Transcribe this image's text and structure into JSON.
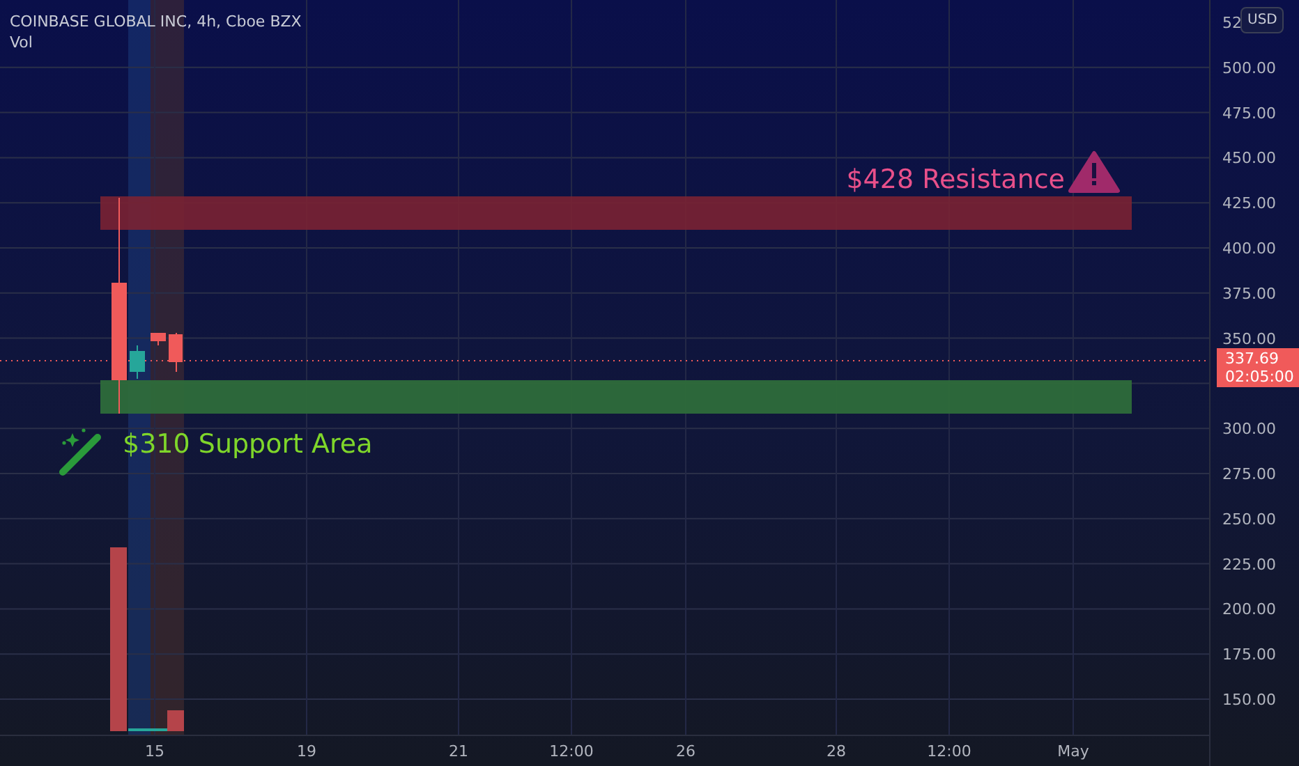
{
  "legend": {
    "title": "COINBASE GLOBAL INC, 4h, Cboe BZX",
    "indicator": "Vol"
  },
  "currency_button": "USD",
  "price_axis": {
    "ticks_above_price_tag": [
      "52",
      "500.00",
      "475.00",
      "450.00",
      "425.00",
      "400.00",
      "375.00",
      "350.00"
    ],
    "ticks_below_price_tag": [
      "300.00",
      "275.00",
      "250.00",
      "225.00",
      "200.00",
      "175.00",
      "150.00"
    ]
  },
  "last_price": {
    "price": "337.69",
    "countdown": "02:05:00"
  },
  "time_axis": {
    "ticks": [
      "15",
      "19",
      "21",
      "12:00",
      "26",
      "28",
      "12:00",
      "May"
    ]
  },
  "zones": [
    {
      "kind": "resistance",
      "label": "$428 Resistance"
    },
    {
      "kind": "support",
      "label": "$310 Support Area"
    }
  ]
}
